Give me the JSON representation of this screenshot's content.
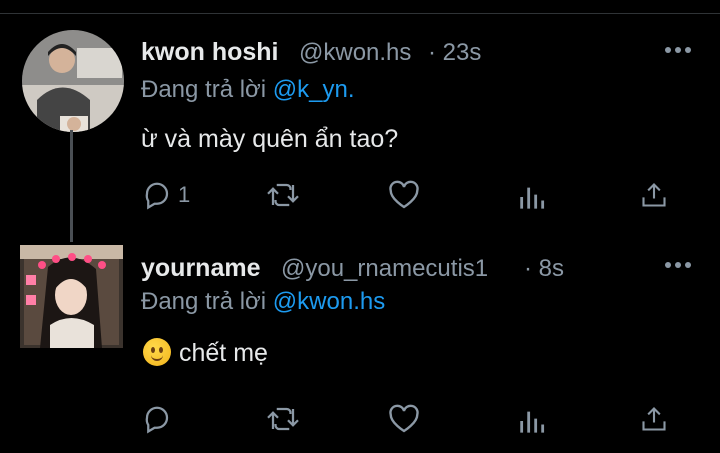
{
  "tweets": [
    {
      "name": "kwon hoshi",
      "handle": "@kwon.hs",
      "time": "· 23s",
      "reply_prefix": "Đang trả lời",
      "reply_to": "@k_yn.",
      "text": "ừ và mày quên ẩn tao?",
      "reply_count": "1",
      "avatar_icon": "profile-photo-man"
    },
    {
      "name": "yourname",
      "handle": "@you_rnamecutis1",
      "time": "· 8s",
      "reply_prefix": "Đang trả lời",
      "reply_to": "@kwon.hs",
      "emoji": "slightly-smiling-face",
      "text": "chết mẹ",
      "reply_count": "",
      "avatar_icon": "profile-photo-girl"
    }
  ],
  "colors": {
    "background": "#000000",
    "text": "#e7e9ea",
    "secondary": "#8b98a5",
    "link": "#1d9bf0"
  },
  "icons": [
    "reply-icon",
    "retweet-icon",
    "like-icon",
    "analytics-icon",
    "share-icon",
    "more-icon"
  ]
}
